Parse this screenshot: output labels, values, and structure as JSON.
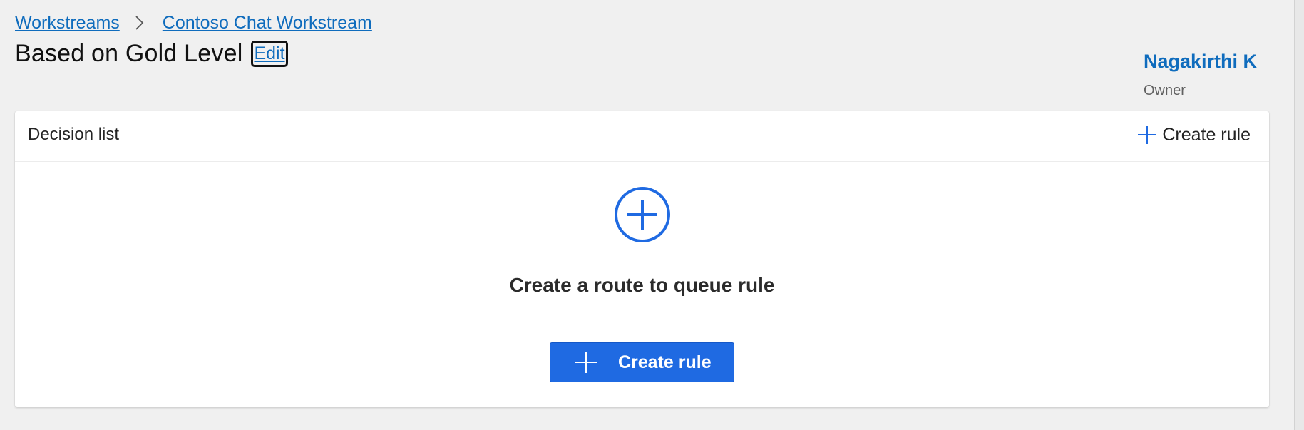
{
  "breadcrumb": {
    "items": [
      "Workstreams",
      "Contoso Chat Workstream"
    ]
  },
  "header": {
    "title": "Based on Gold Level",
    "edit_label": "Edit"
  },
  "owner": {
    "name": "Nagakirthi K",
    "role": "Owner"
  },
  "panel": {
    "title": "Decision list",
    "header_action_label": "Create rule",
    "empty_message": "Create a route to queue rule",
    "primary_button_label": "Create rule"
  },
  "colors": {
    "accent": "#0f6cbd",
    "button": "#1f6ae2",
    "background": "#f0f0f0"
  },
  "icons": {
    "breadcrumb_separator": "chevron-right-icon",
    "header_action": "plus-icon",
    "empty_state": "circle-plus-icon",
    "button": "plus-icon"
  }
}
